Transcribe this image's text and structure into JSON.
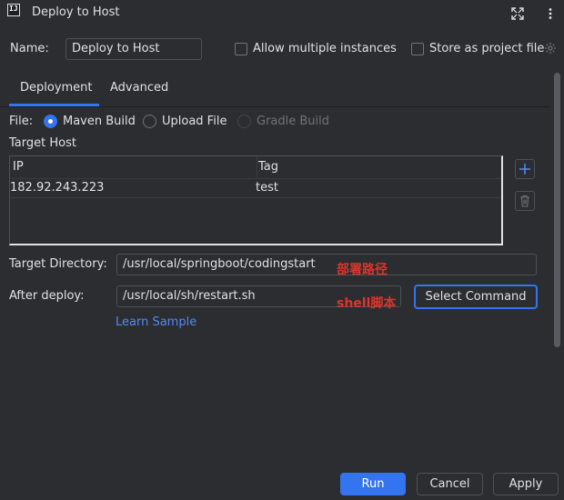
{
  "window": {
    "title": "Deploy to Host",
    "icon_text": "IJ"
  },
  "header": {
    "name_label": "Name:",
    "name_value": "Deploy to Host",
    "allow_multiple_label": "Allow multiple instances",
    "allow_multiple_checked": false,
    "store_project_label": "Store as project file",
    "store_project_checked": false
  },
  "tabs": [
    {
      "label": "Deployment",
      "active": true
    },
    {
      "label": "Advanced",
      "active": false
    }
  ],
  "file": {
    "label": "File:",
    "options": [
      {
        "label": "Maven Build",
        "selected": true,
        "enabled": true
      },
      {
        "label": "Upload File",
        "selected": false,
        "enabled": true
      },
      {
        "label": "Gradle Build",
        "selected": false,
        "enabled": false
      }
    ]
  },
  "target_host": {
    "label": "Target Host",
    "columns": [
      "IP",
      "Tag"
    ],
    "rows": [
      {
        "ip": "182.92.243.223",
        "tag": "test"
      }
    ]
  },
  "target_directory": {
    "label": "Target Directory:",
    "value": "/usr/local/springboot/codingstart",
    "annotation": "部署路径"
  },
  "after_deploy": {
    "label": "After deploy:",
    "value": "/usr/local/sh/restart.sh",
    "annotation": "shell脚本",
    "select_command_label": "Select Command"
  },
  "learn_sample_label": "Learn Sample",
  "footer": {
    "run_label": "Run",
    "cancel_label": "Cancel",
    "apply_label": "Apply"
  },
  "colors": {
    "background": "#2b2d30",
    "accent": "#3574f0",
    "link": "#548af7",
    "annotation": "#e0342b"
  }
}
